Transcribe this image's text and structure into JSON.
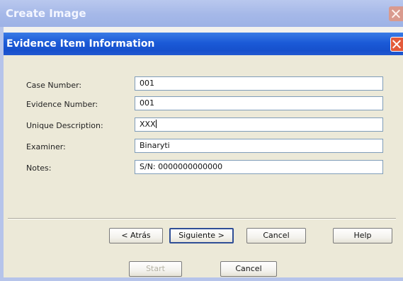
{
  "background_window": {
    "title": "Create Image",
    "start_label": "Start",
    "cancel_label": "Cancel"
  },
  "dialog": {
    "title": "Evidence Item Information",
    "fields": [
      {
        "label": "Case Number:",
        "value": "001"
      },
      {
        "label": "Evidence Number:",
        "value": "001"
      },
      {
        "label": "Unique Description:",
        "value": "XXX"
      },
      {
        "label": "Examiner:",
        "value": "Binaryti"
      },
      {
        "label": "Notes:",
        "value": "S/N: 0000000000000"
      }
    ],
    "buttons": {
      "back": "< Atrás",
      "next": "Siguiente >",
      "cancel": "Cancel",
      "help": "Help"
    }
  }
}
